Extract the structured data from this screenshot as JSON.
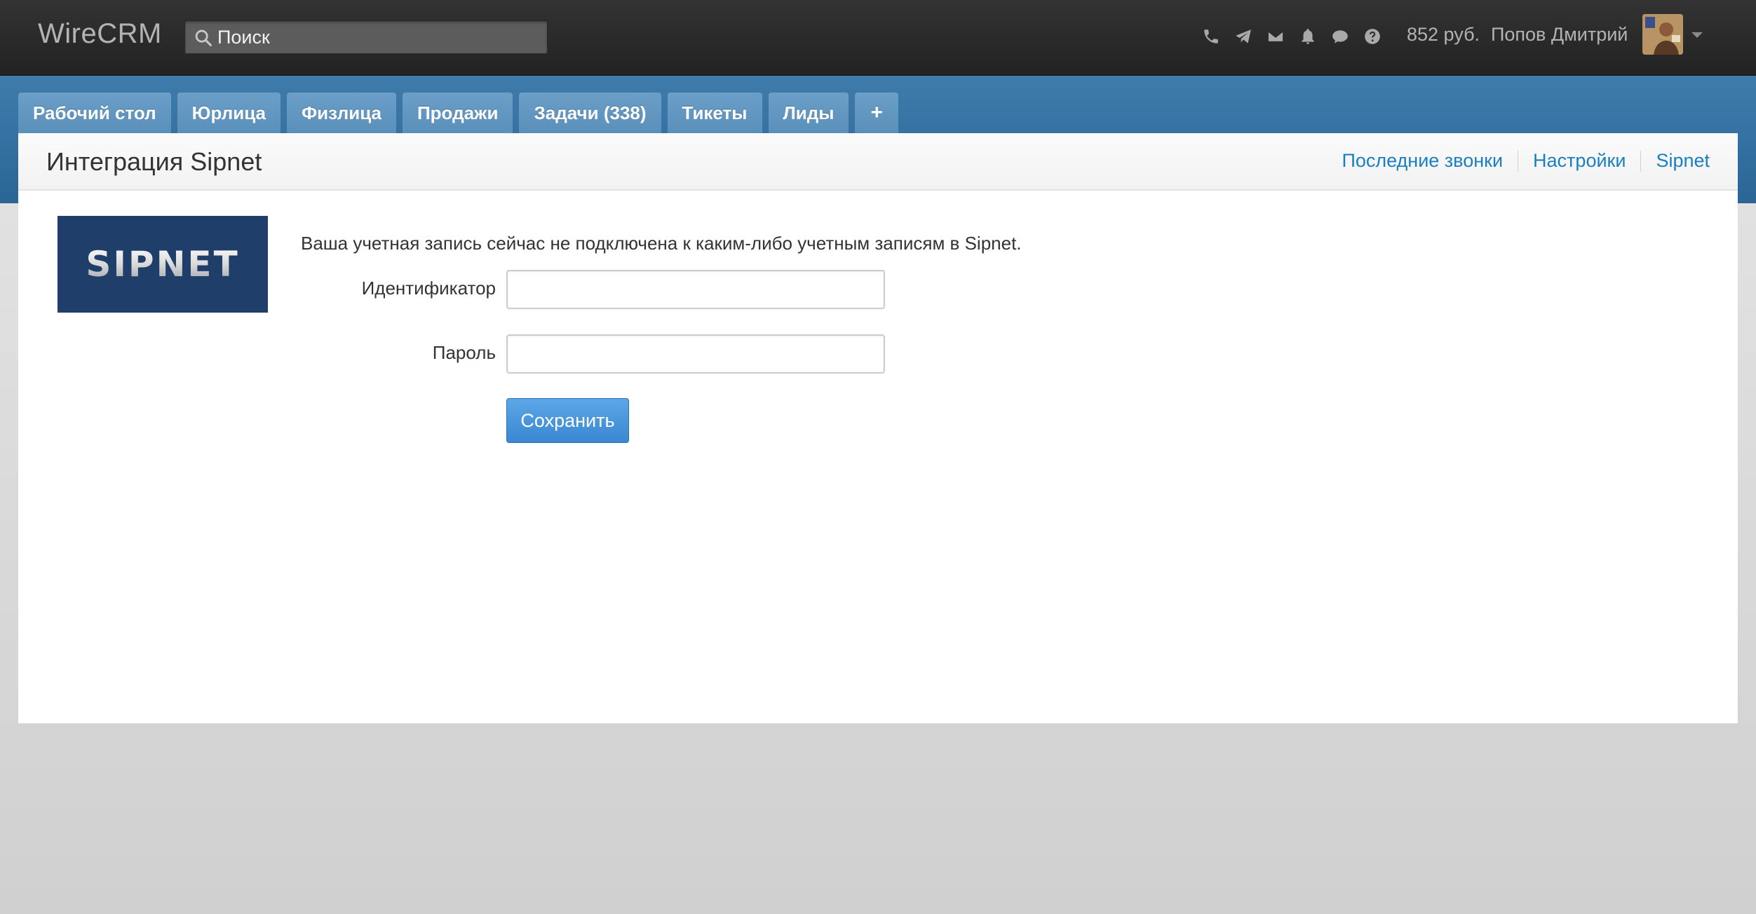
{
  "navbar": {
    "brand": "WireCRM",
    "search_placeholder": "Поиск",
    "icons": [
      "phone-icon",
      "send-icon",
      "envelope-icon",
      "bell-icon",
      "chat-icon",
      "help-icon"
    ],
    "balance": "852 руб.",
    "user_name": "Попов Дмитрий"
  },
  "tabs": [
    {
      "label": "Рабочий стол"
    },
    {
      "label": "Юрлица"
    },
    {
      "label": "Физлица"
    },
    {
      "label": "Продажи"
    },
    {
      "label": "Задачи (338)"
    },
    {
      "label": "Тикеты"
    },
    {
      "label": "Лиды"
    },
    {
      "label": "+"
    }
  ],
  "page": {
    "title": "Интеграция Sipnet",
    "links": [
      {
        "label": "Последние звонки"
      },
      {
        "label": "Настройки"
      },
      {
        "label": "Sipnet"
      }
    ],
    "logo_text": "SIPNET",
    "notice": "Ваша учетная запись сейчас не подключена к каким-либо учетным записям в Sipnet.",
    "form": {
      "id_label": "Идентификатор",
      "id_value": "",
      "password_label": "Пароль",
      "password_value": "",
      "save_label": "Сохранить"
    }
  },
  "colors": {
    "navbar_bg": "#2b2b2b",
    "band_blue": "#3572a3",
    "tab_blue": "#6399c4",
    "link_blue": "#1a7fc1",
    "button_blue": "#4a97dc",
    "logo_bg": "#1f3f6a"
  }
}
